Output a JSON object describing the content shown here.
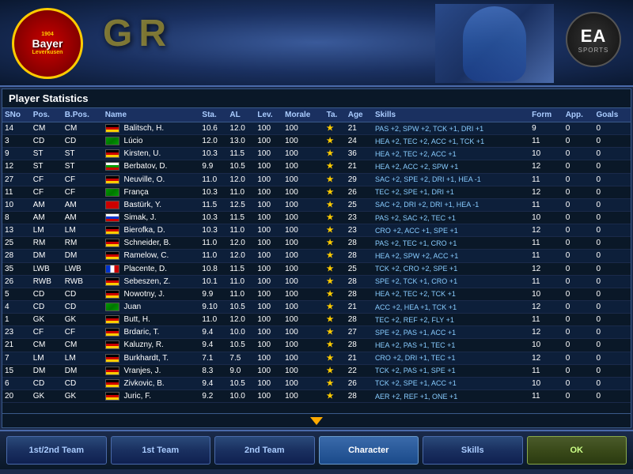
{
  "header": {
    "club_name": "Bayer",
    "club_year": "1904",
    "club_city": "Leverkusen",
    "game_title": "GR",
    "ea_label": "EA",
    "ea_sports": "SPORTS"
  },
  "section": {
    "title": "Player Statistics"
  },
  "table": {
    "columns": [
      "SNo",
      "Pos.",
      "B.Pos.",
      "Name",
      "Sta.",
      "AL",
      "Lev.",
      "Morale",
      "Ta.",
      "Age",
      "Skills",
      "Form",
      "App.",
      "Goals"
    ],
    "rows": [
      {
        "sno": "14",
        "pos": "CM",
        "bpos": "CM",
        "name": "Balitsch, H.",
        "sta": "10.6",
        "al": "12.0",
        "lev": "100",
        "morale": "100",
        "ta": "★",
        "age": "21",
        "skills": "PAS +2, SPW +2, TCK +1, DRI +1",
        "form": "9",
        "app": "0",
        "goals": "0",
        "flag": "de"
      },
      {
        "sno": "3",
        "pos": "CD",
        "bpos": "CD",
        "name": "Lúcio",
        "sta": "12.0",
        "al": "13.0",
        "lev": "100",
        "morale": "100",
        "ta": "★",
        "age": "24",
        "skills": "HEA +2, TEC +2, ACC +1, TCK +1",
        "form": "11",
        "app": "0",
        "goals": "0",
        "flag": "br"
      },
      {
        "sno": "9",
        "pos": "ST",
        "bpos": "ST",
        "name": "Kirsten, U.",
        "sta": "10.3",
        "al": "11.5",
        "lev": "100",
        "morale": "100",
        "ta": "★",
        "age": "36",
        "skills": "HEA +2, TEC +2, ACC +1",
        "form": "10",
        "app": "0",
        "goals": "0",
        "flag": "de"
      },
      {
        "sno": "12",
        "pos": "ST",
        "bpos": "ST",
        "name": "Berbatov, D.",
        "sta": "9.9",
        "al": "10.5",
        "lev": "100",
        "morale": "100",
        "ta": "★",
        "age": "21",
        "skills": "HEA +2, ACC +2, SPW +1",
        "form": "12",
        "app": "0",
        "goals": "0",
        "flag": "bg"
      },
      {
        "sno": "27",
        "pos": "CF",
        "bpos": "CF",
        "name": "Neuville, O.",
        "sta": "11.0",
        "al": "12.0",
        "lev": "100",
        "morale": "100",
        "ta": "★",
        "age": "29",
        "skills": "SAC +2, SPE +2, DRI +1, HEA -1",
        "form": "11",
        "app": "0",
        "goals": "0",
        "flag": "de"
      },
      {
        "sno": "11",
        "pos": "CF",
        "bpos": "CF",
        "name": "França",
        "sta": "10.3",
        "al": "11.0",
        "lev": "100",
        "morale": "100",
        "ta": "★",
        "age": "26",
        "skills": "TEC +2, SPE +1, DRI +1",
        "form": "12",
        "app": "0",
        "goals": "0",
        "flag": "br"
      },
      {
        "sno": "10",
        "pos": "AM",
        "bpos": "AM",
        "name": "Bastürk, Y.",
        "sta": "11.5",
        "al": "12.5",
        "lev": "100",
        "morale": "100",
        "ta": "★",
        "age": "25",
        "skills": "SAC +2, DRI +2, DRI +1, HEA -1",
        "form": "11",
        "app": "0",
        "goals": "0",
        "flag": "tr"
      },
      {
        "sno": "8",
        "pos": "AM",
        "bpos": "AM",
        "name": "Simak, J.",
        "sta": "10.3",
        "al": "11.5",
        "lev": "100",
        "morale": "100",
        "ta": "★",
        "age": "23",
        "skills": "PAS +2, SAC +2, TEC +1",
        "form": "10",
        "app": "0",
        "goals": "0",
        "flag": "sk"
      },
      {
        "sno": "13",
        "pos": "LM",
        "bpos": "LM",
        "name": "Bierofka, D.",
        "sta": "10.3",
        "al": "11.0",
        "lev": "100",
        "morale": "100",
        "ta": "★",
        "age": "23",
        "skills": "CRO +2, ACC +1, SPE +1",
        "form": "12",
        "app": "0",
        "goals": "0",
        "flag": "de"
      },
      {
        "sno": "25",
        "pos": "RM",
        "bpos": "RM",
        "name": "Schneider, B.",
        "sta": "11.0",
        "al": "12.0",
        "lev": "100",
        "morale": "100",
        "ta": "★",
        "age": "28",
        "skills": "PAS +2, TEC +1, CRO +1",
        "form": "11",
        "app": "0",
        "goals": "0",
        "flag": "de"
      },
      {
        "sno": "28",
        "pos": "DM",
        "bpos": "DM",
        "name": "Ramelow, C.",
        "sta": "11.0",
        "al": "12.0",
        "lev": "100",
        "morale": "100",
        "ta": "★",
        "age": "28",
        "skills": "HEA +2, SPW +2, ACC +1",
        "form": "11",
        "app": "0",
        "goals": "0",
        "flag": "de"
      },
      {
        "sno": "35",
        "pos": "LWB",
        "bpos": "LWB",
        "name": "Placente, D.",
        "sta": "10.8",
        "al": "11.5",
        "lev": "100",
        "morale": "100",
        "ta": "★",
        "age": "25",
        "skills": "TCK +2, CRO +2, SPE +1",
        "form": "12",
        "app": "0",
        "goals": "0",
        "flag": "fr"
      },
      {
        "sno": "26",
        "pos": "RWB",
        "bpos": "RWB",
        "name": "Sebeszen, Z.",
        "sta": "10.1",
        "al": "11.0",
        "lev": "100",
        "morale": "100",
        "ta": "★",
        "age": "28",
        "skills": "SPE +2, TCK +1, CRO +1",
        "form": "11",
        "app": "0",
        "goals": "0",
        "flag": "de"
      },
      {
        "sno": "5",
        "pos": "CD",
        "bpos": "CD",
        "name": "Nowotny, J.",
        "sta": "9.9",
        "al": "11.0",
        "lev": "100",
        "morale": "100",
        "ta": "★",
        "age": "28",
        "skills": "HEA +2, TEC +2, TCK +1",
        "form": "10",
        "app": "0",
        "goals": "0",
        "flag": "de"
      },
      {
        "sno": "4",
        "pos": "CD",
        "bpos": "CD",
        "name": "Juan",
        "sta": "9.10",
        "al": "10.5",
        "lev": "100",
        "morale": "100",
        "ta": "★",
        "age": "21",
        "skills": "ACC +2, HEA +1, TCK +1",
        "form": "12",
        "app": "0",
        "goals": "0",
        "flag": "br"
      },
      {
        "sno": "1",
        "pos": "GK",
        "bpos": "GK",
        "name": "Butt, H.",
        "sta": "11.0",
        "al": "12.0",
        "lev": "100",
        "morale": "100",
        "ta": "★",
        "age": "28",
        "skills": "TEC +2, REF +2, FLY +1",
        "form": "11",
        "app": "0",
        "goals": "0",
        "flag": "de"
      },
      {
        "sno": "23",
        "pos": "CF",
        "bpos": "CF",
        "name": "Brdaric, T.",
        "sta": "9.4",
        "al": "10.0",
        "lev": "100",
        "morale": "100",
        "ta": "★",
        "age": "27",
        "skills": "SPE +2, PAS +1, ACC +1",
        "form": "12",
        "app": "0",
        "goals": "0",
        "flag": "de"
      },
      {
        "sno": "21",
        "pos": "CM",
        "bpos": "CM",
        "name": "Kaluzny, R.",
        "sta": "9.4",
        "al": "10.5",
        "lev": "100",
        "morale": "100",
        "ta": "★",
        "age": "28",
        "skills": "HEA +2, PAS +1, TEC +1",
        "form": "10",
        "app": "0",
        "goals": "0",
        "flag": "de"
      },
      {
        "sno": "7",
        "pos": "LM",
        "bpos": "LM",
        "name": "Burkhardt, T.",
        "sta": "7.1",
        "al": "7.5",
        "lev": "100",
        "morale": "100",
        "ta": "★",
        "age": "21",
        "skills": "CRO +2, DRI +1, TEC +1",
        "form": "12",
        "app": "0",
        "goals": "0",
        "flag": "de"
      },
      {
        "sno": "15",
        "pos": "DM",
        "bpos": "DM",
        "name": "Vranjes, J.",
        "sta": "8.3",
        "al": "9.0",
        "lev": "100",
        "morale": "100",
        "ta": "★",
        "age": "22",
        "skills": "TCK +2, PAS +1, SPE +1",
        "form": "11",
        "app": "0",
        "goals": "0",
        "flag": "de"
      },
      {
        "sno": "6",
        "pos": "CD",
        "bpos": "CD",
        "name": "Zivkovic, B.",
        "sta": "9.4",
        "al": "10.5",
        "lev": "100",
        "morale": "100",
        "ta": "★",
        "age": "26",
        "skills": "TCK +2, SPE +1, ACC +1",
        "form": "10",
        "app": "0",
        "goals": "0",
        "flag": "de"
      },
      {
        "sno": "20",
        "pos": "GK",
        "bpos": "GK",
        "name": "Juric, F.",
        "sta": "9.2",
        "al": "10.0",
        "lev": "100",
        "morale": "100",
        "ta": "★",
        "age": "28",
        "skills": "AER +2, REF +1, ONE +1",
        "form": "11",
        "app": "0",
        "goals": "0",
        "flag": "de"
      }
    ]
  },
  "nav": {
    "btn1": "1st/2nd Team",
    "btn2": "1st Team",
    "btn3": "2nd Team",
    "btn4": "Character",
    "btn5": "Skills",
    "btn6": "OK"
  }
}
